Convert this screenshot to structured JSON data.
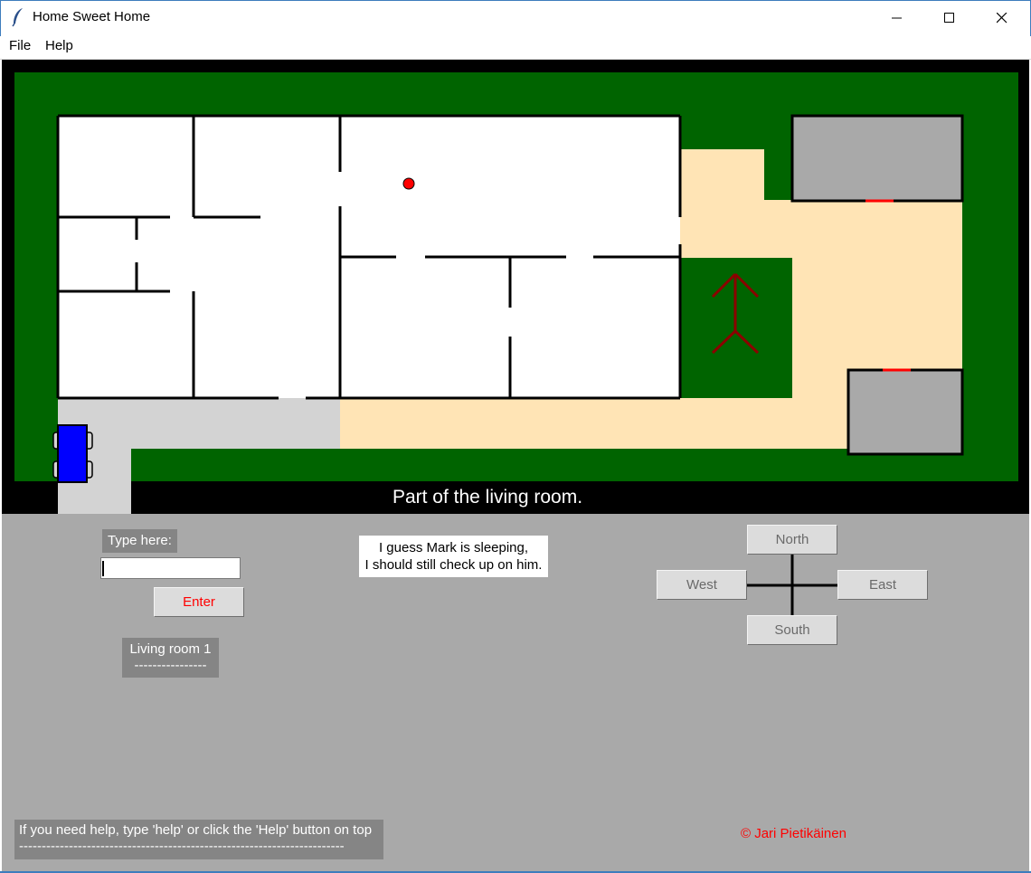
{
  "window": {
    "title": "Home Sweet Home",
    "minimize_glyph": "—",
    "maximize_glyph": "☐",
    "close_glyph": "✕"
  },
  "menu": {
    "items": [
      {
        "label": "File"
      },
      {
        "label": "Help"
      }
    ]
  },
  "map": {
    "colors": {
      "frame": "#000000",
      "grass": "#006400",
      "house": "#ffffff",
      "path": "#ffe4b5",
      "driveway": "#d3d3d3",
      "shed": "#a9a9a9",
      "door": "#ff0000",
      "car": "#0000ff",
      "tree": "#8b0000",
      "player": "#ff0000"
    },
    "location_text": "Part of the living room."
  },
  "panel": {
    "type_label": "Type here:",
    "input_value": "",
    "enter_label": "Enter",
    "room_name": "Living room 1",
    "room_underline": "----------------",
    "message_line1": "I guess Mark is sleeping,",
    "message_line2": "I should still check up on him.",
    "directions": {
      "north": "North",
      "south": "South",
      "west": "West",
      "east": "East"
    },
    "help_line": "If you need help, type 'help' or click the 'Help' button on top",
    "help_underline": "------------------------------------------------------------------------",
    "copyright": "© Jari Pietikäinen"
  }
}
